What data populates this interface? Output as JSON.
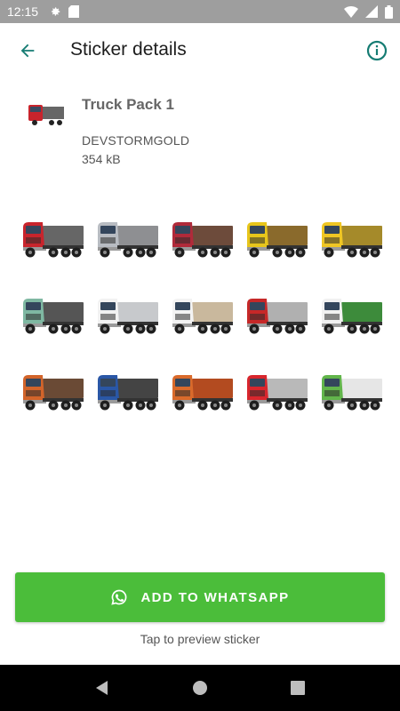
{
  "status_bar": {
    "time": "12:15",
    "left_icons": [
      "gear-icon",
      "sd-card-icon"
    ],
    "right_icons": [
      "wifi-icon",
      "signal-icon",
      "battery-icon"
    ]
  },
  "app_bar": {
    "title": "Sticker details",
    "back_icon": "arrow-left-icon",
    "info_icon": "info-icon"
  },
  "pack": {
    "name": "Truck Pack 1",
    "publisher": "DEVSTORMGOLD",
    "size": "354 kB"
  },
  "stickers": [
    {
      "cab": "#c8242c",
      "body": "#666666"
    },
    {
      "cab": "#b8bcc2",
      "body": "#8e8f92"
    },
    {
      "cab": "#b02a3a",
      "body": "#6d4b3b"
    },
    {
      "cab": "#e7c51b",
      "body": "#8a6a2c"
    },
    {
      "cab": "#efc623",
      "body": "#a58a2a"
    },
    {
      "cab": "#7fb8a2",
      "body": "#555555"
    },
    {
      "cab": "#f2f2f2",
      "body": "#c7c9cc"
    },
    {
      "cab": "#f3f3f3",
      "body": "#c9b89d"
    },
    {
      "cab": "#c62828",
      "body": "#b0b0b0"
    },
    {
      "cab": "#f1f1f1",
      "body": "#3d8b3b"
    },
    {
      "cab": "#d2642a",
      "body": "#6a4a35"
    },
    {
      "cab": "#2a57a6",
      "body": "#444444"
    },
    {
      "cab": "#d96a2b",
      "body": "#b34b20"
    },
    {
      "cab": "#d8262d",
      "body": "#b9b9b9"
    },
    {
      "cab": "#62b54b",
      "body": "#e6e6e6"
    }
  ],
  "actions": {
    "add_label": "ADD TO WHATSAPP",
    "add_icon": "whatsapp-icon",
    "preview_hint": "Tap to preview sticker"
  },
  "nav_bar": {
    "icons": [
      "back-triangle-icon",
      "home-circle-icon",
      "recents-square-icon"
    ]
  },
  "colors": {
    "accent": "#167c73",
    "button_green": "#4bbd3a",
    "status_bar": "#9e9e9e"
  }
}
